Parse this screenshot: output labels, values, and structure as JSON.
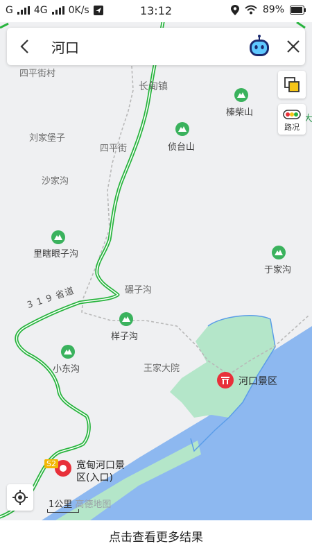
{
  "status_bar": {
    "carrier_1": "G",
    "carrier_2": "4G",
    "speed": "0K/s",
    "time": "13:12",
    "battery": "89%"
  },
  "search": {
    "query": "河口",
    "back_icon": "chevron-left-icon",
    "assistant_icon": "assistant-avatar-icon",
    "close_icon": "close-icon"
  },
  "controls": {
    "layers_icon": "layers-icon",
    "traffic_label": "路况",
    "locate_icon": "locate-icon"
  },
  "map": {
    "place_labels": {
      "siping_village": "四平街村",
      "changdian": "长甸镇",
      "liujiapuzi": "刘家堡子",
      "sipingjie": "四平街",
      "shajiagou": "沙家沟",
      "nianzigou": "碾子沟",
      "wangjiadayuan": "王家大院"
    },
    "pois": {
      "zhencaishan": "榛柴山",
      "zhentaishan": "侦台山",
      "lixiayanzigou": "里瞎眼子沟",
      "yujiagou": "于家沟",
      "yangzigou": "样子沟",
      "xiaodonggou": "小东沟",
      "hekou_scenic": "河口景区",
      "entrance_1": "宽甸河口景",
      "entrance_2": "区(入口)"
    },
    "road_label": "3 1 9 省道",
    "road_badge": "S2",
    "edge_char": "大",
    "scale": "1公里",
    "watermark": "高德地图"
  },
  "bottom_bar": {
    "label": "点击查看更多结果"
  },
  "colors": {
    "land": "#eff0f2",
    "water": "#8db8f0",
    "park": "#b4e6c9",
    "road_green": "#27b43d",
    "marker_red": "#e8303a"
  }
}
